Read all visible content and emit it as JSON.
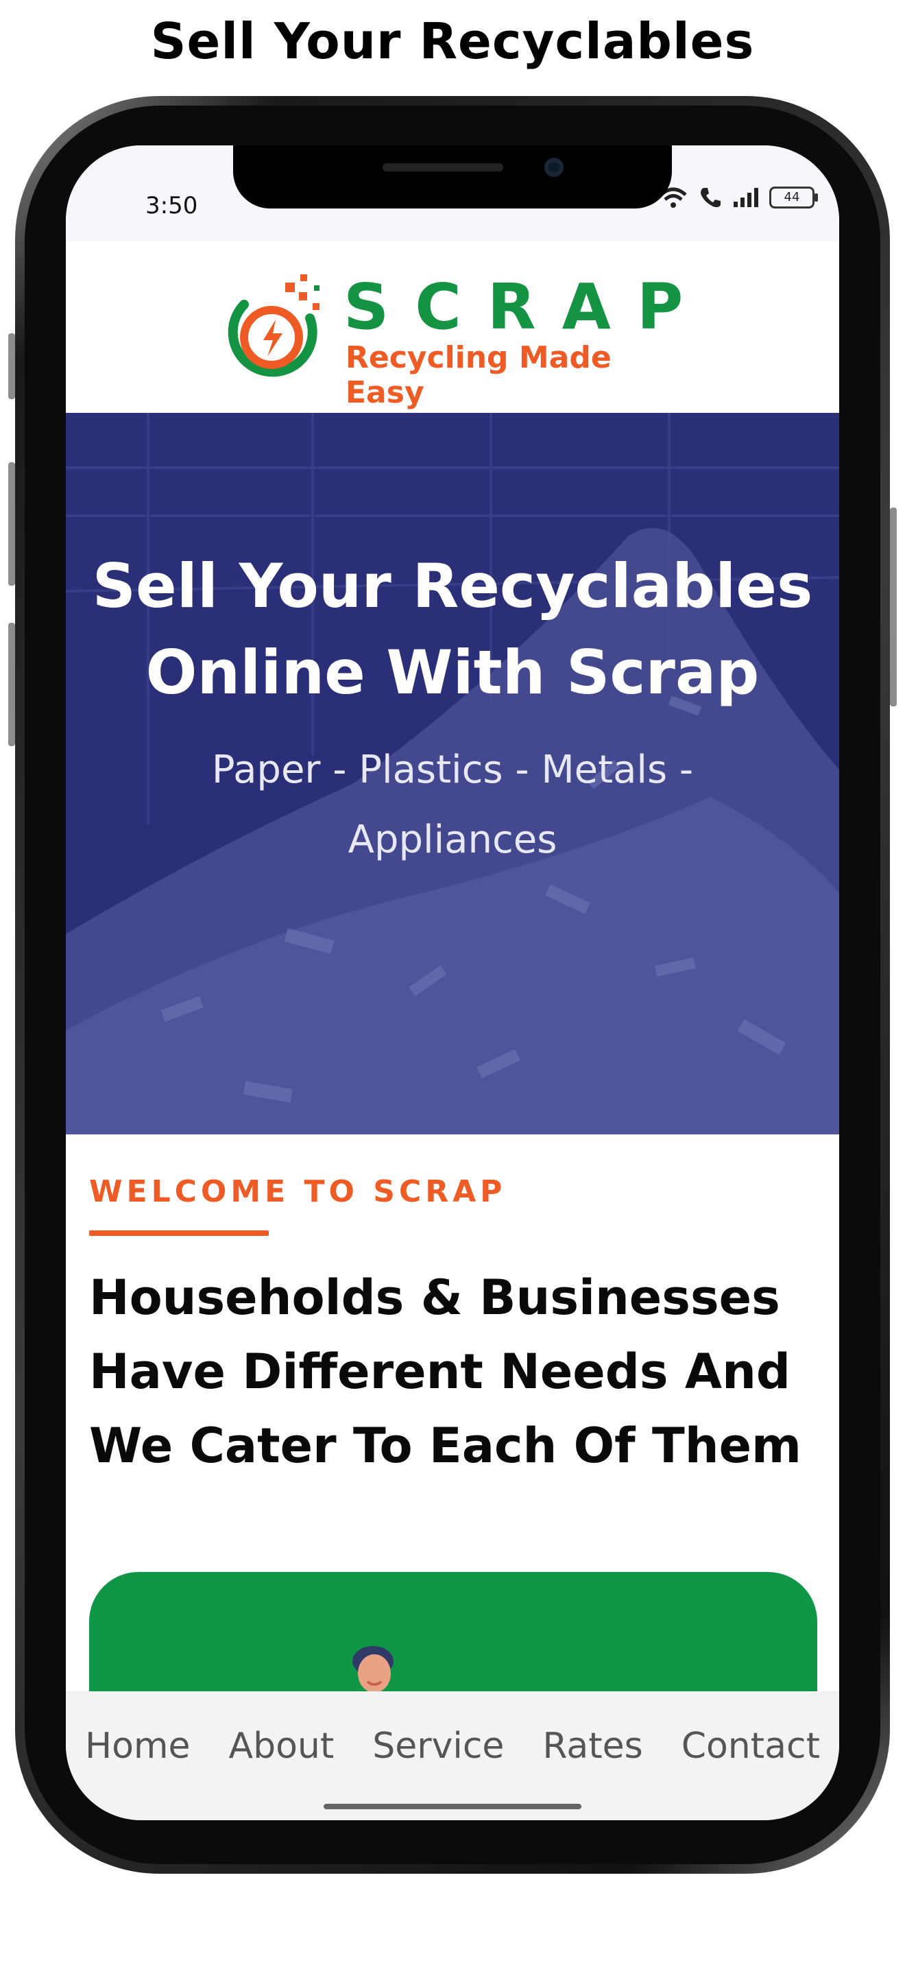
{
  "banner": {
    "title": "Sell Your Recyclables"
  },
  "status_bar": {
    "time": "3:50",
    "battery": "44"
  },
  "logo": {
    "name": "SCRAP",
    "tagline": "Recycling Made Easy"
  },
  "hero": {
    "title_line1": "Sell Your Recyclables",
    "title_line2": "Online With Scrap",
    "subtitle_line1": "Paper - Plastics - Metals -",
    "subtitle_line2": "Appliances"
  },
  "welcome": {
    "eyebrow": "WELCOME TO SCRAP",
    "heading_line1": "Households & Businesses",
    "heading_line2": "Have Different Needs And",
    "heading_line3": "We Cater To Each Of Them"
  },
  "tabs": [
    {
      "label": "Home"
    },
    {
      "label": "About"
    },
    {
      "label": "Service"
    },
    {
      "label": "Rates"
    },
    {
      "label": "Contact"
    }
  ],
  "colors": {
    "brand_green": "#149343",
    "brand_orange": "#ee5b24",
    "hero_overlay": "#2b2f78",
    "card_green": "#0f9647"
  }
}
